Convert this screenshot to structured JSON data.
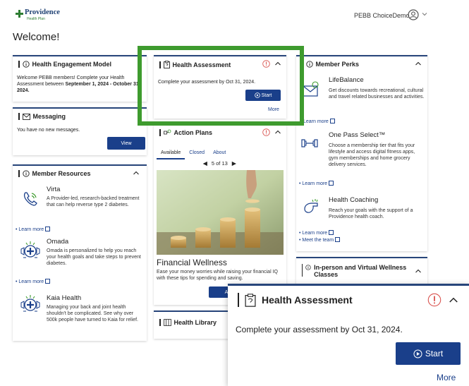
{
  "header": {
    "logo_name": "Providence",
    "logo_sub": "Health Plan",
    "user_name": "PEBB ChoiceDemo"
  },
  "welcome": "Welcome!",
  "engagement": {
    "title": "Health Engagement Model",
    "text_plain": "Welcome PEBB members! Complete your Health Assessment between ",
    "text_bold": "September 1, 2024 - October 31, 2024."
  },
  "messaging": {
    "title": "Messaging",
    "text": "You have no new messages.",
    "button": "View"
  },
  "resources": {
    "title": "Member Resources",
    "items": [
      {
        "name": "Virta",
        "desc": "A Provider-led, research-backed treatment that can help reverse type 2 diabetes.",
        "link": "Learn more"
      },
      {
        "name": "Omada",
        "desc": "Omada is personalized to help you reach your health goals and take steps to prevent diabetes.",
        "link": "Learn more"
      },
      {
        "name": "Kaia Health",
        "desc": "Managing your back and joint health shouldn't be complicated. See why over 500k people have turned to Kaia for relief."
      }
    ]
  },
  "assessment": {
    "title": "Health Assessment",
    "text": "Complete your assessment by Oct 31, 2024.",
    "button": "Start",
    "more": "More"
  },
  "action_plans": {
    "title": "Action Plans",
    "tabs": [
      "Available",
      "Closed",
      "About"
    ],
    "pager": "5 of 13",
    "plan_title": "Financial Wellness",
    "plan_desc": "Ease your money worries while raising your financial IQ with these tips for spending and saving.",
    "button": "A"
  },
  "library": {
    "title": "Health Library"
  },
  "perks": {
    "title": "Member Perks",
    "items": [
      {
        "name": "LifeBalance",
        "desc": "Get discounts towards recreational, cultural and travel related businesses and activities.",
        "link": "Learn more"
      },
      {
        "name": "One Pass Select™",
        "desc": "Choose a membership tier that fits your lifestyle and access digital fitness apps, gym memberships and home grocery delivery services.",
        "link": "Learn more"
      },
      {
        "name": "Health Coaching",
        "desc": "Reach your goals with the support of a Providence health coach.",
        "link": "Learn more",
        "link2": "Meet the team"
      }
    ]
  },
  "classes": {
    "title": "In-person and Virtual Wellness Classes"
  },
  "zoom": {
    "title": "Health Assessment",
    "text": "Complete your assessment by Oct 31, 2024.",
    "button": "Start",
    "more": "More"
  },
  "colors": {
    "brand_navy": "#27457a",
    "button_blue": "#1a3f8a",
    "highlight_green": "#3e9b2e",
    "alert_red": "#d9534f"
  }
}
